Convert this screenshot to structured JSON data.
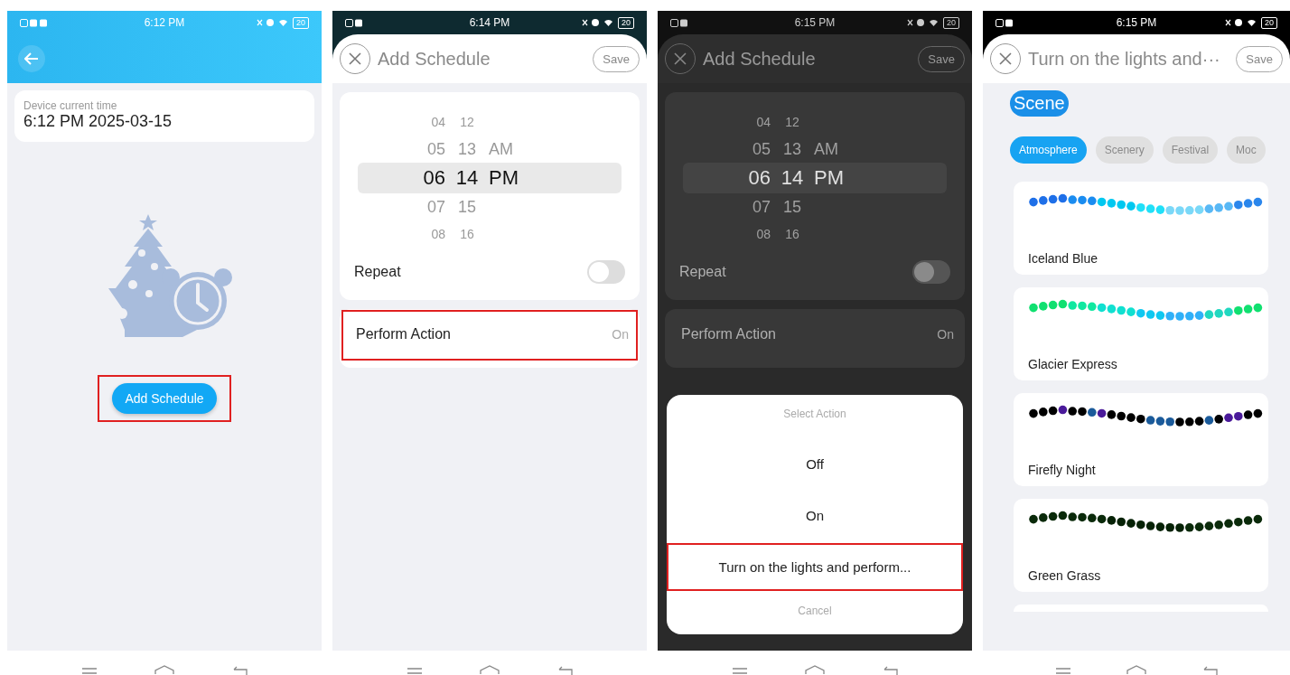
{
  "screens": [
    {
      "kind": "device_time",
      "status_bar": {
        "time": "6:12 PM",
        "battery": "20"
      },
      "device_time_label": "Device current time",
      "device_time": "6:12 PM 2025-03-15",
      "add_button": {
        "label": "Add Schedule",
        "highlighted": true
      }
    },
    {
      "kind": "add_schedule",
      "dimmed": false,
      "status_bar": {
        "time": "6:14 PM",
        "battery": "20"
      },
      "title": "Add Schedule",
      "save": "Save",
      "picker": [
        {
          "hour": "04",
          "minute": "12",
          "selected": false
        },
        {
          "hour": "05",
          "minute": "13",
          "period": "AM",
          "selected": false
        },
        {
          "hour": "06",
          "minute": "14",
          "period": "PM",
          "selected": true
        },
        {
          "hour": "07",
          "minute": "15",
          "selected": false
        },
        {
          "hour": "08",
          "minute": "16",
          "selected": false
        }
      ],
      "repeat": {
        "label": "Repeat",
        "on": false
      },
      "perform_action": {
        "label": "Perform Action",
        "value": "On",
        "highlighted": true
      }
    },
    {
      "kind": "add_schedule",
      "dimmed": true,
      "status_bar": {
        "time": "6:15 PM",
        "battery": "20"
      },
      "title": "Add Schedule",
      "save": "Save",
      "picker": [
        {
          "hour": "04",
          "minute": "12",
          "selected": false
        },
        {
          "hour": "05",
          "minute": "13",
          "period": "AM",
          "selected": false
        },
        {
          "hour": "06",
          "minute": "14",
          "period": "PM",
          "selected": true
        },
        {
          "hour": "07",
          "minute": "15",
          "selected": false
        },
        {
          "hour": "08",
          "minute": "16",
          "selected": false
        }
      ],
      "repeat": {
        "label": "Repeat",
        "on": false
      },
      "perform_action": {
        "label": "Perform Action",
        "value": "On",
        "highlighted": false
      },
      "sheet": {
        "title": "Select Action",
        "options": [
          {
            "label": "Off",
            "highlighted": false
          },
          {
            "label": "On",
            "highlighted": false
          },
          {
            "label": "Turn on the lights and perform...",
            "highlighted": true
          }
        ],
        "cancel": "Cancel"
      }
    },
    {
      "kind": "scene_select",
      "status_bar": {
        "time": "6:15 PM",
        "battery": "20"
      },
      "title": "Turn on the lights and···",
      "save": "Save",
      "section": "Scene",
      "tabs": [
        {
          "label": "Atmosphere",
          "selected": true
        },
        {
          "label": "Scenery",
          "selected": false
        },
        {
          "label": "Festival",
          "selected": false
        },
        {
          "label": "Moc",
          "selected": false
        }
      ],
      "scenes": [
        {
          "name": "Iceland Blue"
        },
        {
          "name": "Glacier Express"
        },
        {
          "name": "Firefly Night"
        },
        {
          "name": "Green Grass"
        }
      ]
    }
  ]
}
